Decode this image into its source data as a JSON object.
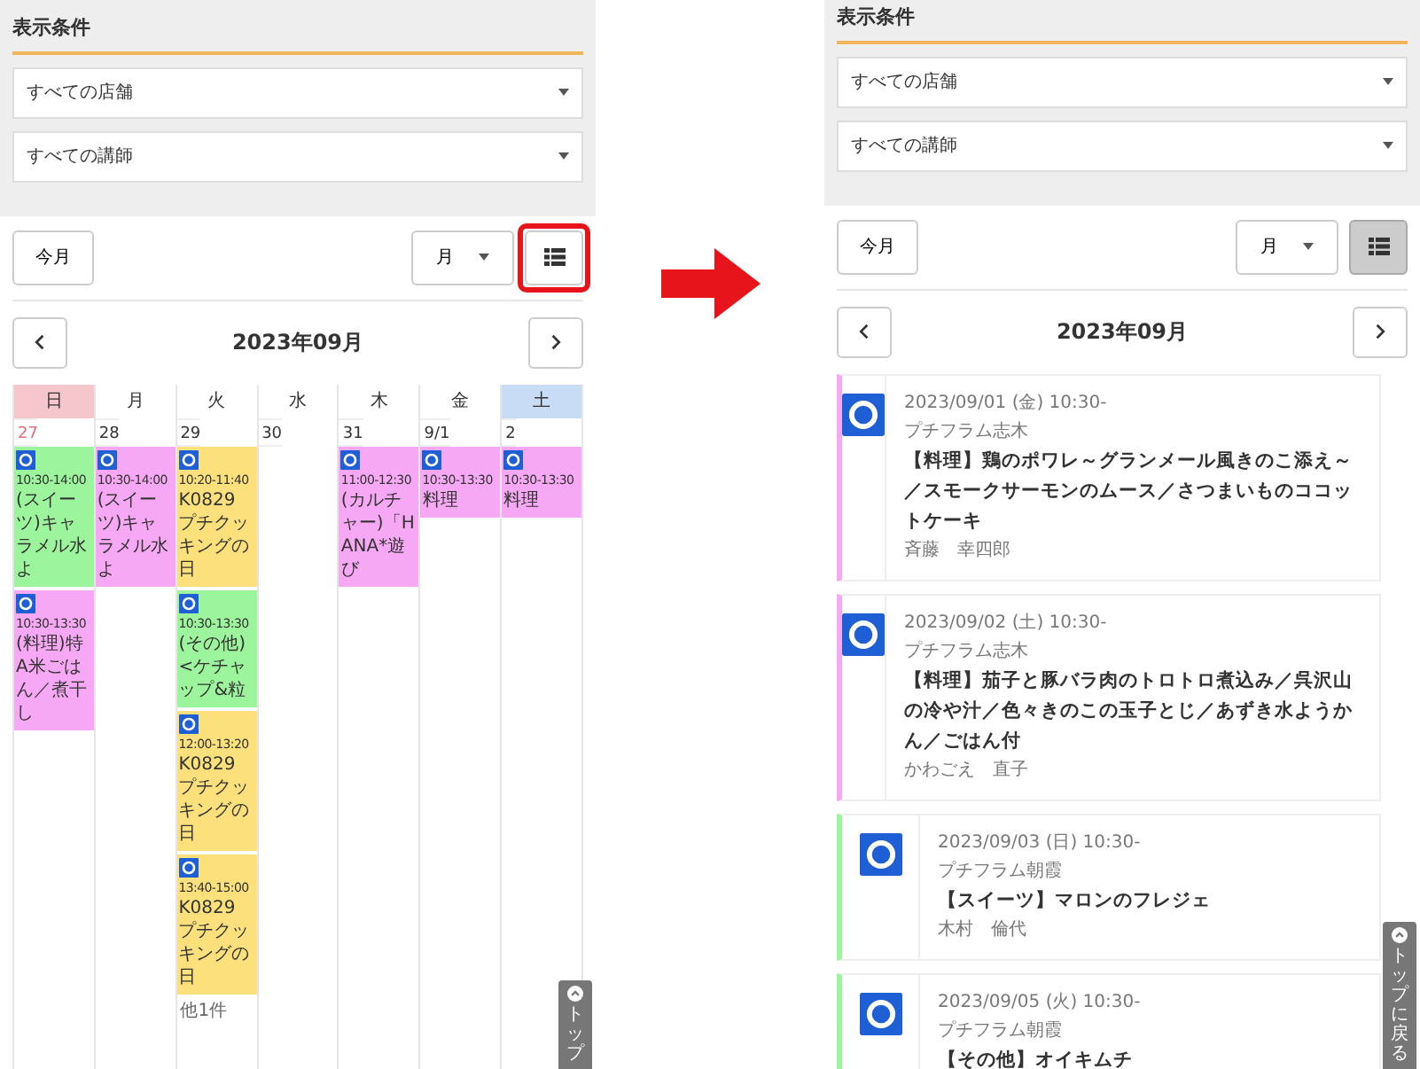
{
  "left": {
    "filter": {
      "title": "表示条件",
      "selects": [
        "すべての店舗",
        "すべての講師"
      ]
    },
    "toolbar": {
      "today": "今月",
      "view": "月",
      "list_view_selected": false,
      "list_button_highlighted": true
    },
    "month": "2023年09月",
    "calendar": {
      "weekdays": [
        {
          "label": "日",
          "kind": "sunday"
        },
        {
          "label": "月",
          "kind": "weekday"
        },
        {
          "label": "火",
          "kind": "weekday"
        },
        {
          "label": "水",
          "kind": "weekday"
        },
        {
          "label": "木",
          "kind": "weekday"
        },
        {
          "label": "金",
          "kind": "weekday"
        },
        {
          "label": "土",
          "kind": "saturday"
        }
      ],
      "days": [
        {
          "date": "27",
          "events": [
            {
              "color": "#9cf59c",
              "time": "10:30-14:00",
              "title": "(スイーツ)キャラメル水よ"
            },
            {
              "color": "#f7a8f4",
              "time": "10:30-13:30",
              "title": "(料理)特A米ごはん／煮干し"
            }
          ]
        },
        {
          "date": "28",
          "events": [
            {
              "color": "#f7a8f4",
              "time": "10:30-14:00",
              "title": "(スイーツ)キャラメル水よ"
            }
          ]
        },
        {
          "date": "29",
          "events": [
            {
              "color": "#fbe07c",
              "time": "10:20-11:40",
              "title": "K0829 プチクッキングの日"
            },
            {
              "color": "#9cf59c",
              "time": "10:30-13:30",
              "title": "(その他)<ケチャップ&粒"
            },
            {
              "color": "#fbe07c",
              "time": "12:00-13:20",
              "title": "K0829 プチクッキングの日"
            },
            {
              "color": "#fbe07c",
              "time": "13:40-15:00",
              "title": "K0829 プチクッキングの日"
            }
          ],
          "more": "他1件"
        },
        {
          "date": "30"
        },
        {
          "date": "31",
          "events": [
            {
              "color": "#f7a8f4",
              "time": "11:00-12:30",
              "title": "(カルチャー)「HANA*遊び"
            }
          ]
        },
        {
          "date": "9/1",
          "events": [
            {
              "color": "#f7a8f4",
              "time": "10:30-13:30",
              "title": "料理"
            }
          ]
        },
        {
          "date": "2",
          "events": [
            {
              "color": "#f7a8f4",
              "time": "10:30-13:30",
              "title": "料理"
            }
          ]
        }
      ]
    },
    "back_to_top": "トップ"
  },
  "right": {
    "filter": {
      "title": "表示条件",
      "selects": [
        "すべての店舗",
        "すべての講師"
      ]
    },
    "toolbar": {
      "today": "今月",
      "view": "月",
      "list_view_selected": true
    },
    "month": "2023年09月",
    "events": [
      {
        "color": "#f7a8f4",
        "date": "2023/09/01 (金) 10:30-",
        "store": "プチフラム志木",
        "title": "【料理】鶏のポワレ～グランメール風きのこ添え～／スモークサーモンのムース／さつまいものココットケーキ",
        "instructor": "斉藤　幸四郎"
      },
      {
        "color": "#f7a8f4",
        "date": "2023/09/02 (土) 10:30-",
        "store": "プチフラム志木",
        "title": "【料理】茄子と豚バラ肉のトロトロ煮込み／呉沢山の冷や汁／色々きのこの玉子とじ／あずき水ようかん／ごはん付",
        "instructor": "かわごえ　直子"
      },
      {
        "color": "#9cf59c",
        "date": "2023/09/03 (日) 10:30-",
        "store": "プチフラム朝霞",
        "title": "【スイーツ】マロンのフレジェ",
        "instructor": "木村　倫代"
      },
      {
        "color": "#9cf59c",
        "date": "2023/09/05 (火) 10:30-",
        "store": "プチフラム朝霞",
        "title": "【その他】オイキムチ"
      }
    ],
    "back_to_top": "トップに戻る"
  }
}
